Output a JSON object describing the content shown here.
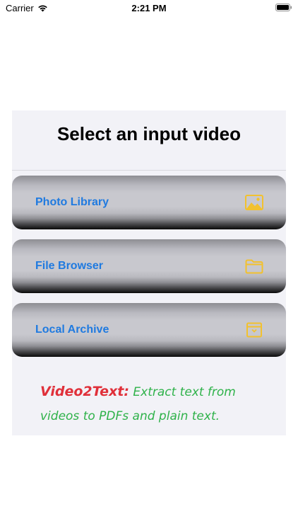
{
  "status_bar": {
    "carrier": "Carrier",
    "time": "2:21 PM"
  },
  "card": {
    "title": "Select an input video"
  },
  "options": [
    {
      "label": "Photo Library",
      "icon": "photo-icon"
    },
    {
      "label": "File Browser",
      "icon": "folder-icon"
    },
    {
      "label": "Local Archive",
      "icon": "archive-icon"
    }
  ],
  "tagline": {
    "brand": "Video2Text:",
    "text": "Extract text from videos to PDFs and plain text."
  },
  "colors": {
    "option_label": "#1f7ae0",
    "icon_accent": "#f2c12e",
    "brand_red": "#e0303a",
    "tagline_green": "#2fb24a",
    "card_background": "#f2f2f7"
  }
}
